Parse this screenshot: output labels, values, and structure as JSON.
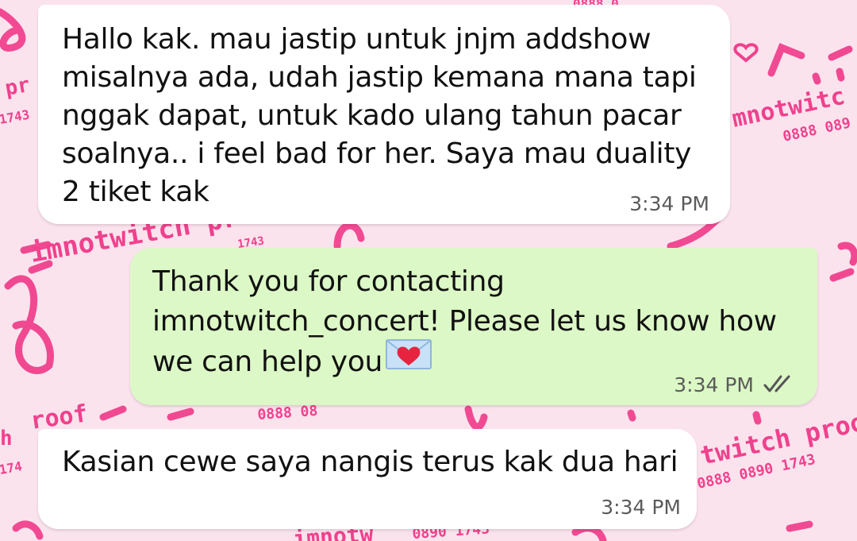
{
  "wallpaper": {
    "watermarks": {
      "brand_full": "imnotwitch pr",
      "brand_right": "mnotwitc",
      "brand_lower": "twitch proo",
      "brand_left": "roof",
      "brand_bottom": "imnotw",
      "phone_top": "0888 0",
      "phone_right": "0888 089",
      "phone_mid": "0888 08",
      "phone_lower": "0888 0890 1743",
      "phone_bottom": "0890 1743",
      "left_pr": "pr",
      "left_1743": "1743",
      "left_174": "174",
      "left_h": "h",
      "num_top": "1743"
    },
    "colors": {
      "background": "#fbe3ee",
      "accent": "#f0418d"
    }
  },
  "messages": [
    {
      "direction": "incoming",
      "text": "Hallo kak. mau jastip untuk jnjm addshow\nmisalnya ada, udah jastip kemana mana tapi\nnggak dapat, untuk kado ulang tahun pacar\nsoalnya.. i feel bad for her. Saya mau duality\n2 tiket kak",
      "time": "3:34 PM"
    },
    {
      "direction": "outgoing",
      "text": "Thank you for contacting\nimnotwitch_concert! Please let us know how\nwe can help you",
      "emoji": "love-letter-emoji",
      "time": "3:34 PM",
      "status": "read-double-check-icon"
    },
    {
      "direction": "incoming",
      "text": "Kasian cewe saya nangis terus kak dua hari",
      "time": "3:34 PM"
    }
  ],
  "colors": {
    "incoming_bubble": "#ffffff",
    "outgoing_bubble": "#dcf8c6",
    "read_ticks": "#555555"
  }
}
